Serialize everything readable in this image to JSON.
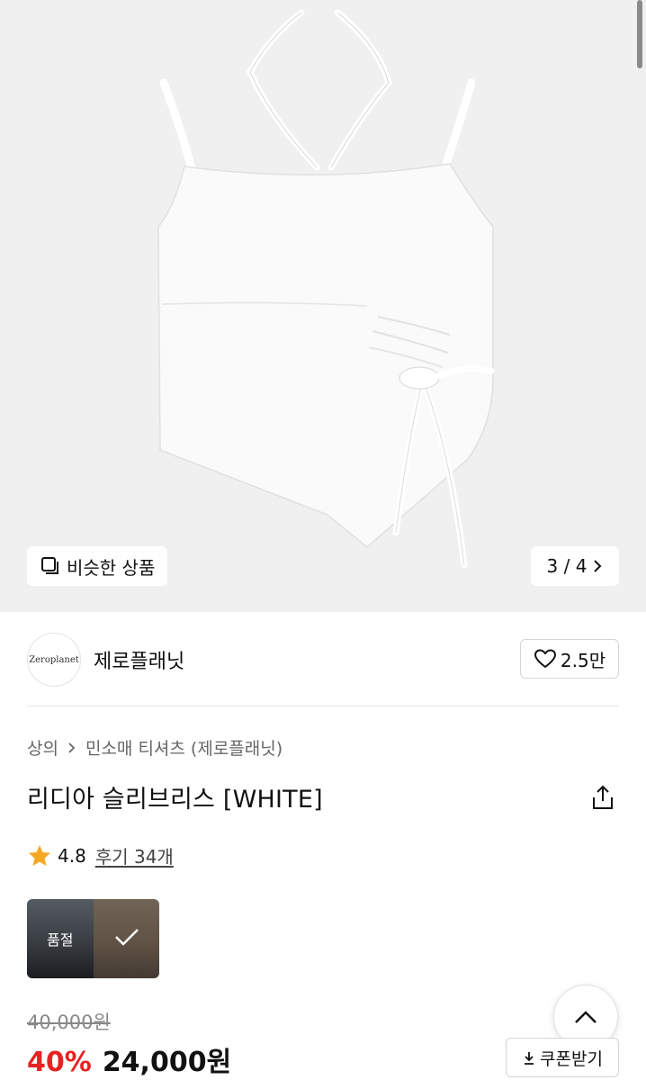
{
  "gallery": {
    "similar_label": "비슷한 상품",
    "pager_text": "3 / 4"
  },
  "brand": {
    "logo_text": "Zeroplanet",
    "name": "제로플래닛",
    "likes": "2.5만"
  },
  "breadcrumb": {
    "items": [
      "상의",
      "민소매 티셔츠 (제로플래닛)"
    ]
  },
  "product": {
    "title": "리디아 슬리브리스 [WHITE]",
    "rating": "4.8",
    "reviews_label": "후기 34개",
    "thumbnails": [
      {
        "badge": "품절"
      },
      {
        "badge": ""
      }
    ]
  },
  "price": {
    "original": "40,000원",
    "discount": "40%",
    "sale": "24,000원"
  },
  "actions": {
    "coupon_label": "쿠폰받기"
  },
  "colors": {
    "discount": "#e62222",
    "star": "#f7a823",
    "hero_bg": "#f0f0f1"
  },
  "icons": [
    "similar-products-icon",
    "chevron-right-icon",
    "heart-icon",
    "share-icon",
    "star-icon",
    "check-icon",
    "chevron-up-icon",
    "download-icon"
  ]
}
